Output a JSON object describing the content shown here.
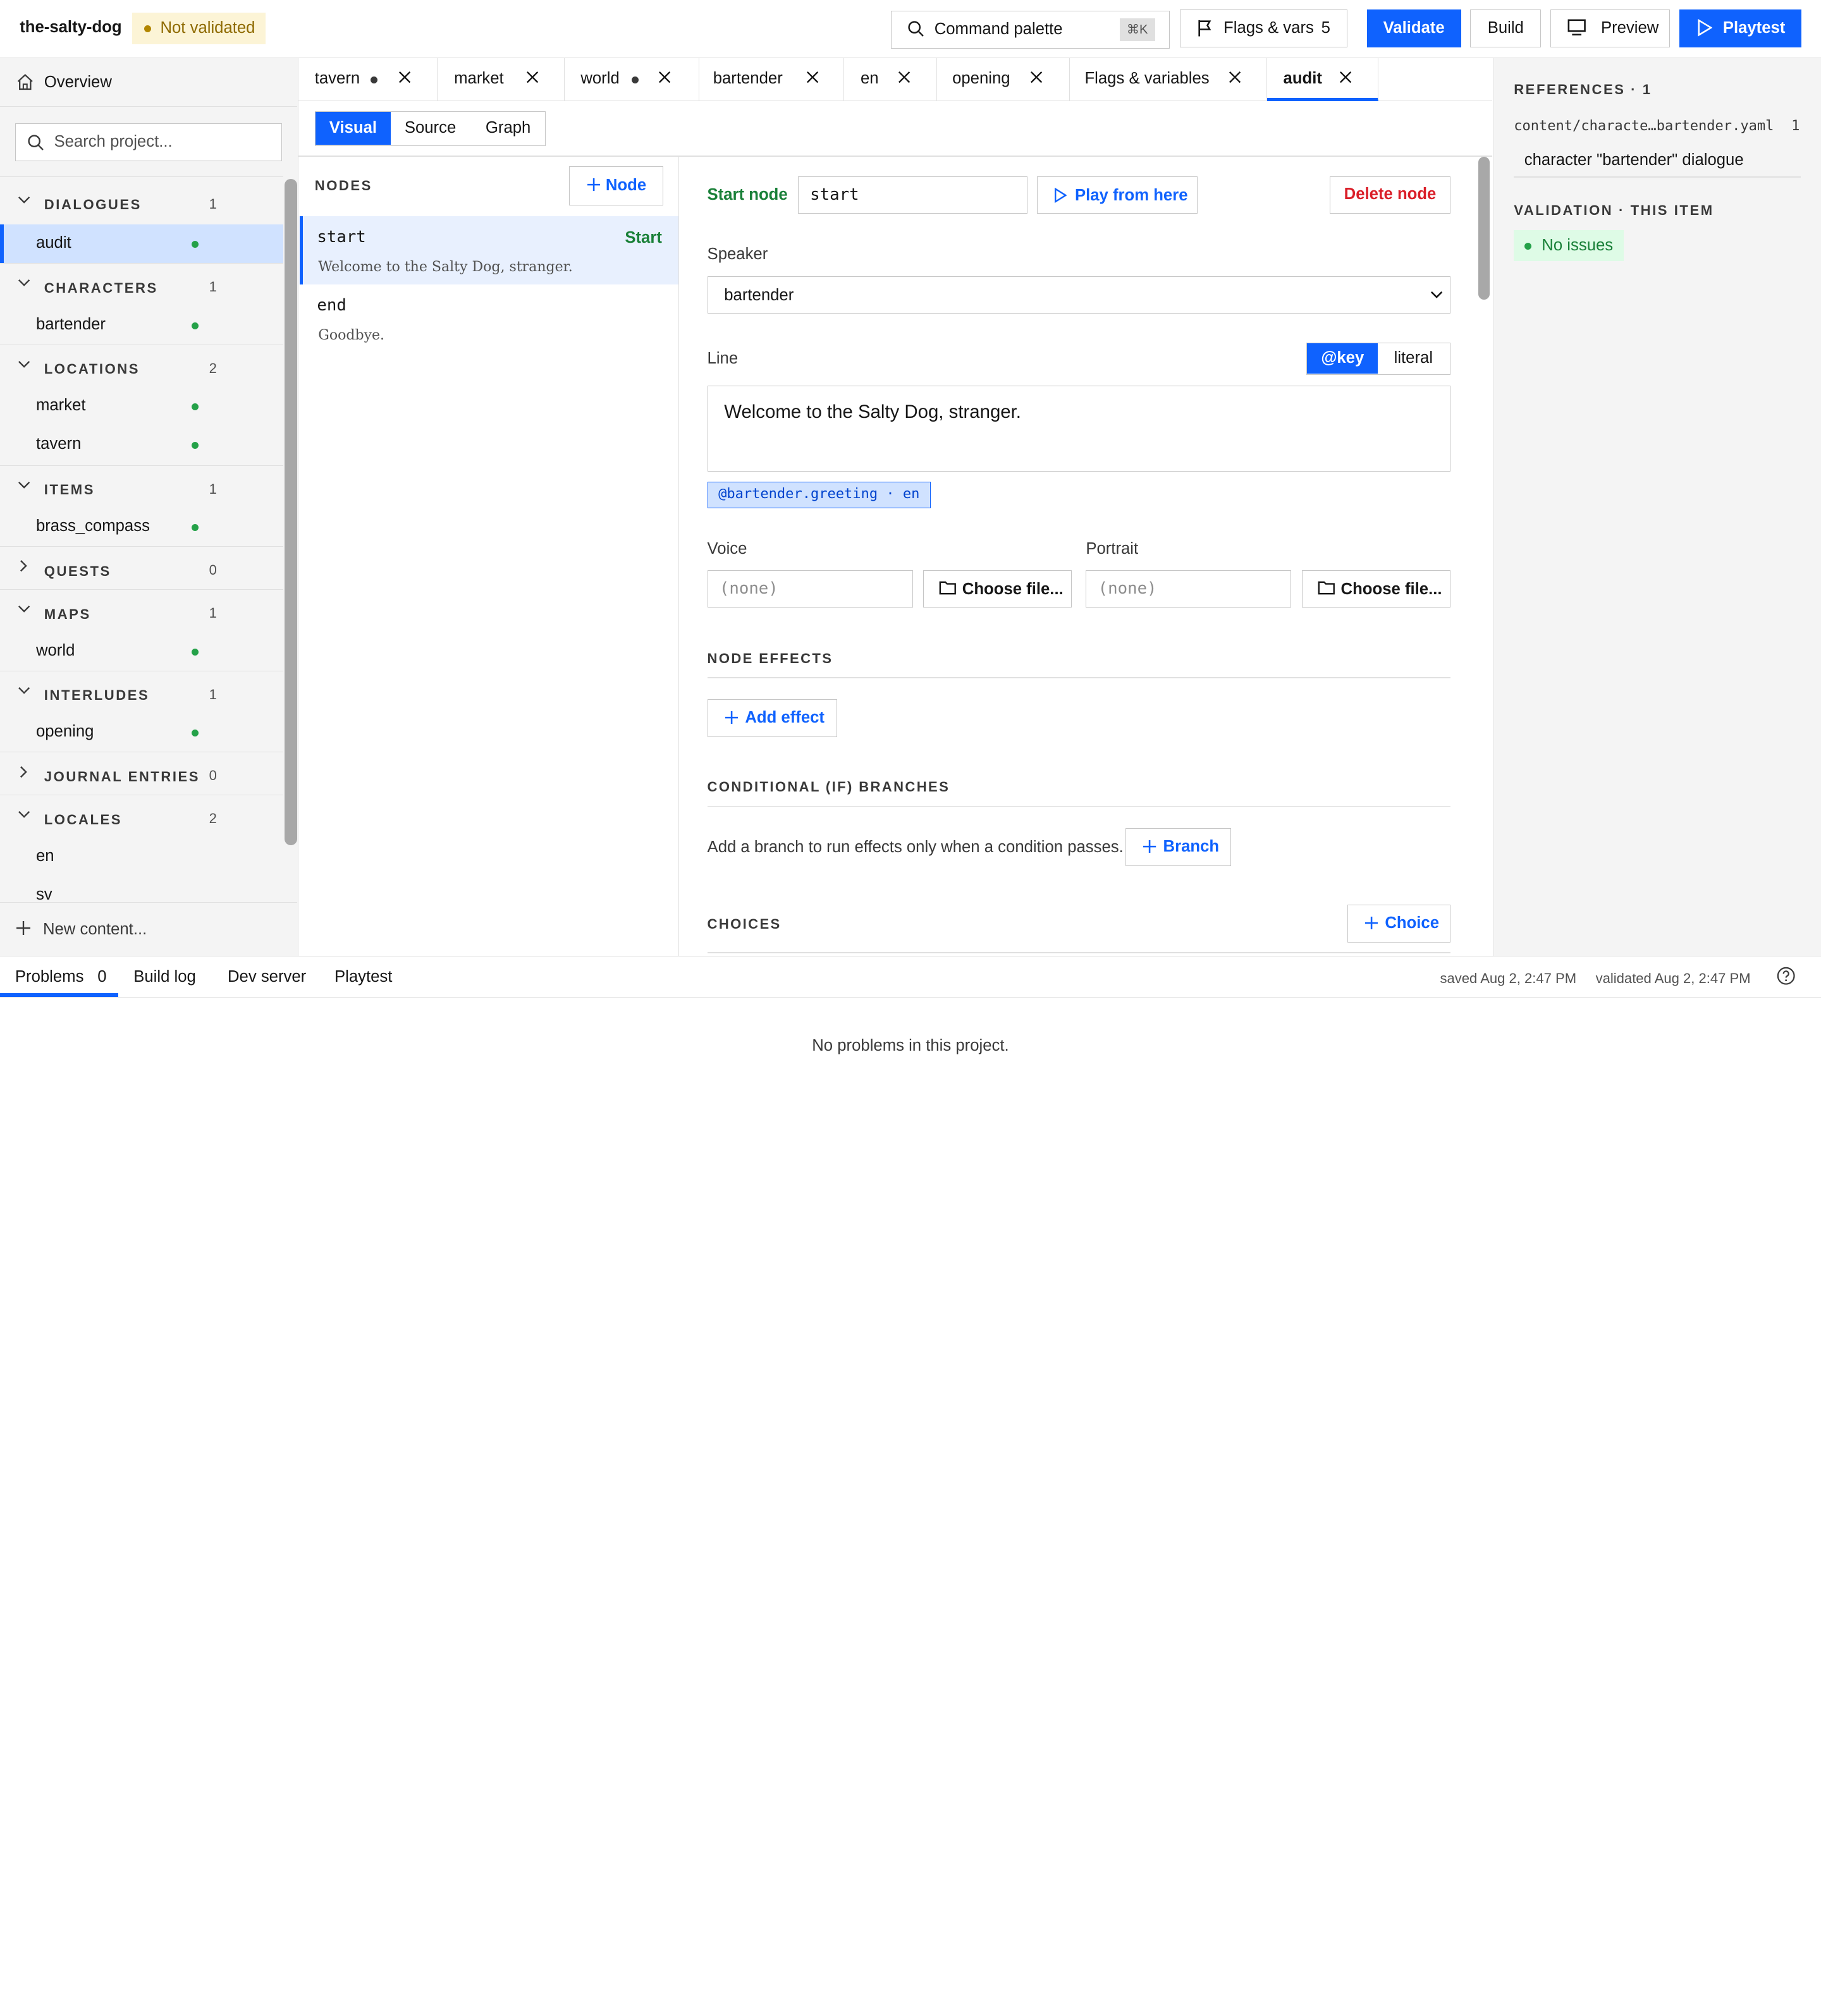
{
  "app": {
    "name": "the-salty-dog",
    "status": "Not validated"
  },
  "topbar": {
    "command_palette": "Command palette",
    "command_shortcut": "⌘K",
    "flags_label": "Flags & vars",
    "flags_count": "5",
    "validate": "Validate",
    "build": "Build",
    "preview": "Preview",
    "playtest": "Playtest"
  },
  "sidebar": {
    "overview": "Overview",
    "search_placeholder": "Search project...",
    "groups": [
      {
        "label": "DIALOGUES",
        "count": "1",
        "items": [
          "audit"
        ]
      },
      {
        "label": "CHARACTERS",
        "count": "1",
        "items": [
          "bartender"
        ]
      },
      {
        "label": "LOCATIONS",
        "count": "2",
        "items": [
          "market",
          "tavern"
        ]
      },
      {
        "label": "ITEMS",
        "count": "1",
        "items": [
          "brass_compass"
        ]
      },
      {
        "label": "QUESTS",
        "count": "0",
        "items": []
      },
      {
        "label": "MAPS",
        "count": "1",
        "items": [
          "world"
        ]
      },
      {
        "label": "INTERLUDES",
        "count": "1",
        "items": [
          "opening"
        ]
      },
      {
        "label": "JOURNAL ENTRIES",
        "count": "0",
        "items": []
      },
      {
        "label": "LOCALES",
        "count": "2",
        "items": [
          "en",
          "sv"
        ]
      }
    ],
    "new_content": "New content..."
  },
  "tabs": [
    {
      "label": "tavern",
      "dirty": true
    },
    {
      "label": "market",
      "dirty": false
    },
    {
      "label": "world",
      "dirty": true
    },
    {
      "label": "bartender",
      "dirty": false
    },
    {
      "label": "en",
      "dirty": false
    },
    {
      "label": "opening",
      "dirty": false
    },
    {
      "label": "Flags & variables",
      "dirty": false
    },
    {
      "label": "audit",
      "dirty": false,
      "active": true
    }
  ],
  "view_modes": [
    "Visual",
    "Source",
    "Graph"
  ],
  "nodes_panel": {
    "header": "NODES",
    "add_label": "Node",
    "nodes": [
      {
        "name": "start",
        "preview": "Welcome to the Salty Dog, stranger.",
        "tag": "Start"
      },
      {
        "name": "end",
        "preview": "Goodbye.",
        "tag": ""
      }
    ]
  },
  "editor": {
    "start_node_label": "Start node",
    "node_id": "start",
    "play_from_here": "Play from here",
    "delete_node": "Delete node",
    "speaker_label": "Speaker",
    "speaker_value": "bartender",
    "line_label": "Line",
    "line_mode_key": "@key",
    "line_mode_literal": "literal",
    "line_text": "Welcome to the Salty Dog, stranger.",
    "key_chip": "@bartender.greeting · en",
    "voice_label": "Voice",
    "voice_value": "(none)",
    "portrait_label": "Portrait",
    "portrait_value": "(none)",
    "choose_file": "Choose file...",
    "node_effects_header": "NODE EFFECTS",
    "add_effect": "Add effect",
    "branches_header": "CONDITIONAL (IF) BRANCHES",
    "branches_hint": "Add a branch to run effects only when a condition passes.",
    "branch_button": "Branch",
    "choices_header": "CHOICES",
    "choice_button": "Choice"
  },
  "right_panel": {
    "references_header": "REFERENCES · 1",
    "ref_path": "content/characte…bartender.yaml",
    "ref_line": "1",
    "ref_desc": "character \"bartender\" dialogue",
    "validation_header": "VALIDATION · THIS ITEM",
    "validation_status": "No issues"
  },
  "bottom": {
    "tabs": [
      "Problems",
      "Build log",
      "Dev server",
      "Playtest"
    ],
    "problems_count": "0",
    "saved": "saved Aug 2, 2:47 PM",
    "validated": "validated Aug 2, 2:47 PM",
    "empty_message": "No problems in this project."
  },
  "colors": {
    "accent": "#0f62fe",
    "success": "#198038",
    "danger": "#da1e28",
    "warning_bg": "#fcf4d6"
  }
}
